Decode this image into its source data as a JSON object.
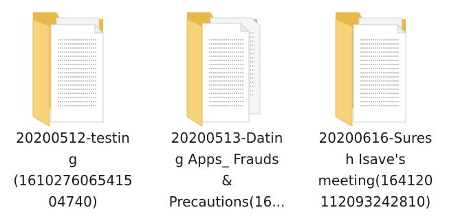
{
  "explorer": {
    "items": [
      {
        "type_icon": "folder-with-documents-icon",
        "name_lines": [
          "20200512-testin",
          "g",
          "(1610276065415",
          "04740)"
        ]
      },
      {
        "type_icon": "folder-with-documents-icon",
        "name_lines": [
          "20200513-Datin",
          "g Apps_ Frauds",
          "&",
          "Precautions(16..."
        ]
      },
      {
        "type_icon": "folder-with-documents-icon",
        "name_lines": [
          "20200616-Sures",
          "h Isave's",
          "meeting(164120",
          "112093242810)"
        ]
      }
    ],
    "colors": {
      "folder_back": "#E8B84A",
      "folder_front": "#F6D37A",
      "folder_front_shade": "#F2C75E",
      "paper": "#FFFFFF",
      "paper_lines": "#8A8A8A"
    }
  }
}
